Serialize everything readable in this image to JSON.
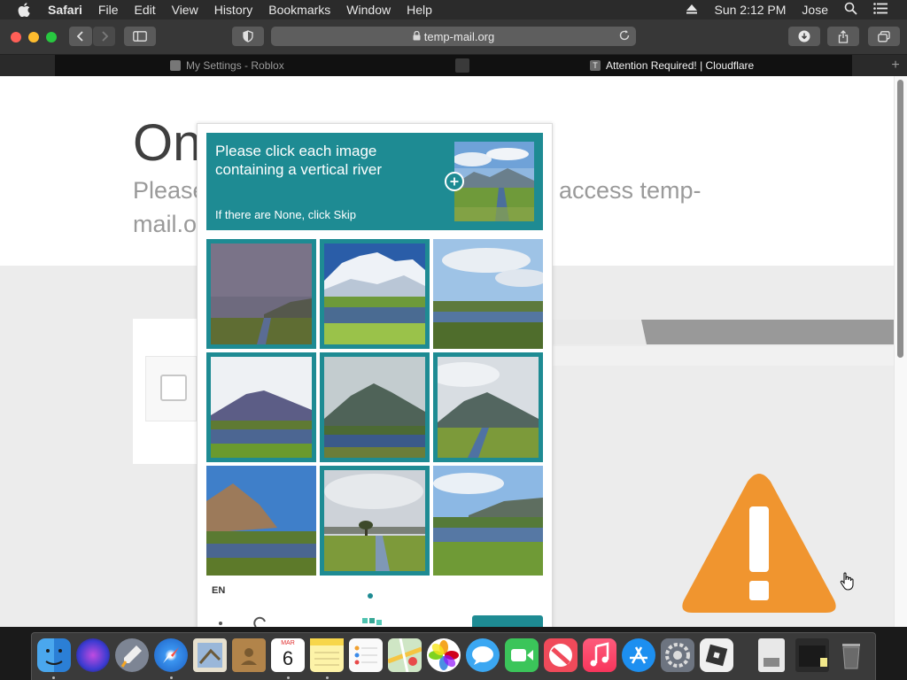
{
  "menubar": {
    "app_name": "Safari",
    "items": [
      "File",
      "Edit",
      "View",
      "History",
      "Bookmarks",
      "Window",
      "Help"
    ],
    "clock": "Sun 2:12 PM",
    "user": "Jose"
  },
  "toolbar": {
    "url": "temp-mail.org"
  },
  "tabs": [
    {
      "title": "My Settings - Roblox",
      "active": false
    },
    {
      "title": "",
      "active": false
    },
    {
      "title": "Attention Required! | Cloudflare",
      "active": true
    }
  ],
  "page": {
    "title_fragment": "On",
    "subtitle_line1": "Please",
    "subtitle_line1_right": "access temp-",
    "subtitle_line2": "mail.o"
  },
  "captcha": {
    "prompt": "Please click each image containing a vertical river",
    "hint": "If there are None, click Skip",
    "language": "EN",
    "accent_color": "#1e8b93",
    "tiles_selected": [
      true,
      true,
      false,
      true,
      true,
      true,
      false,
      true,
      false
    ]
  },
  "colors": {
    "warning": "#f0952f"
  },
  "dock": {
    "calendar_month": "MAR",
    "calendar_day": "6"
  }
}
